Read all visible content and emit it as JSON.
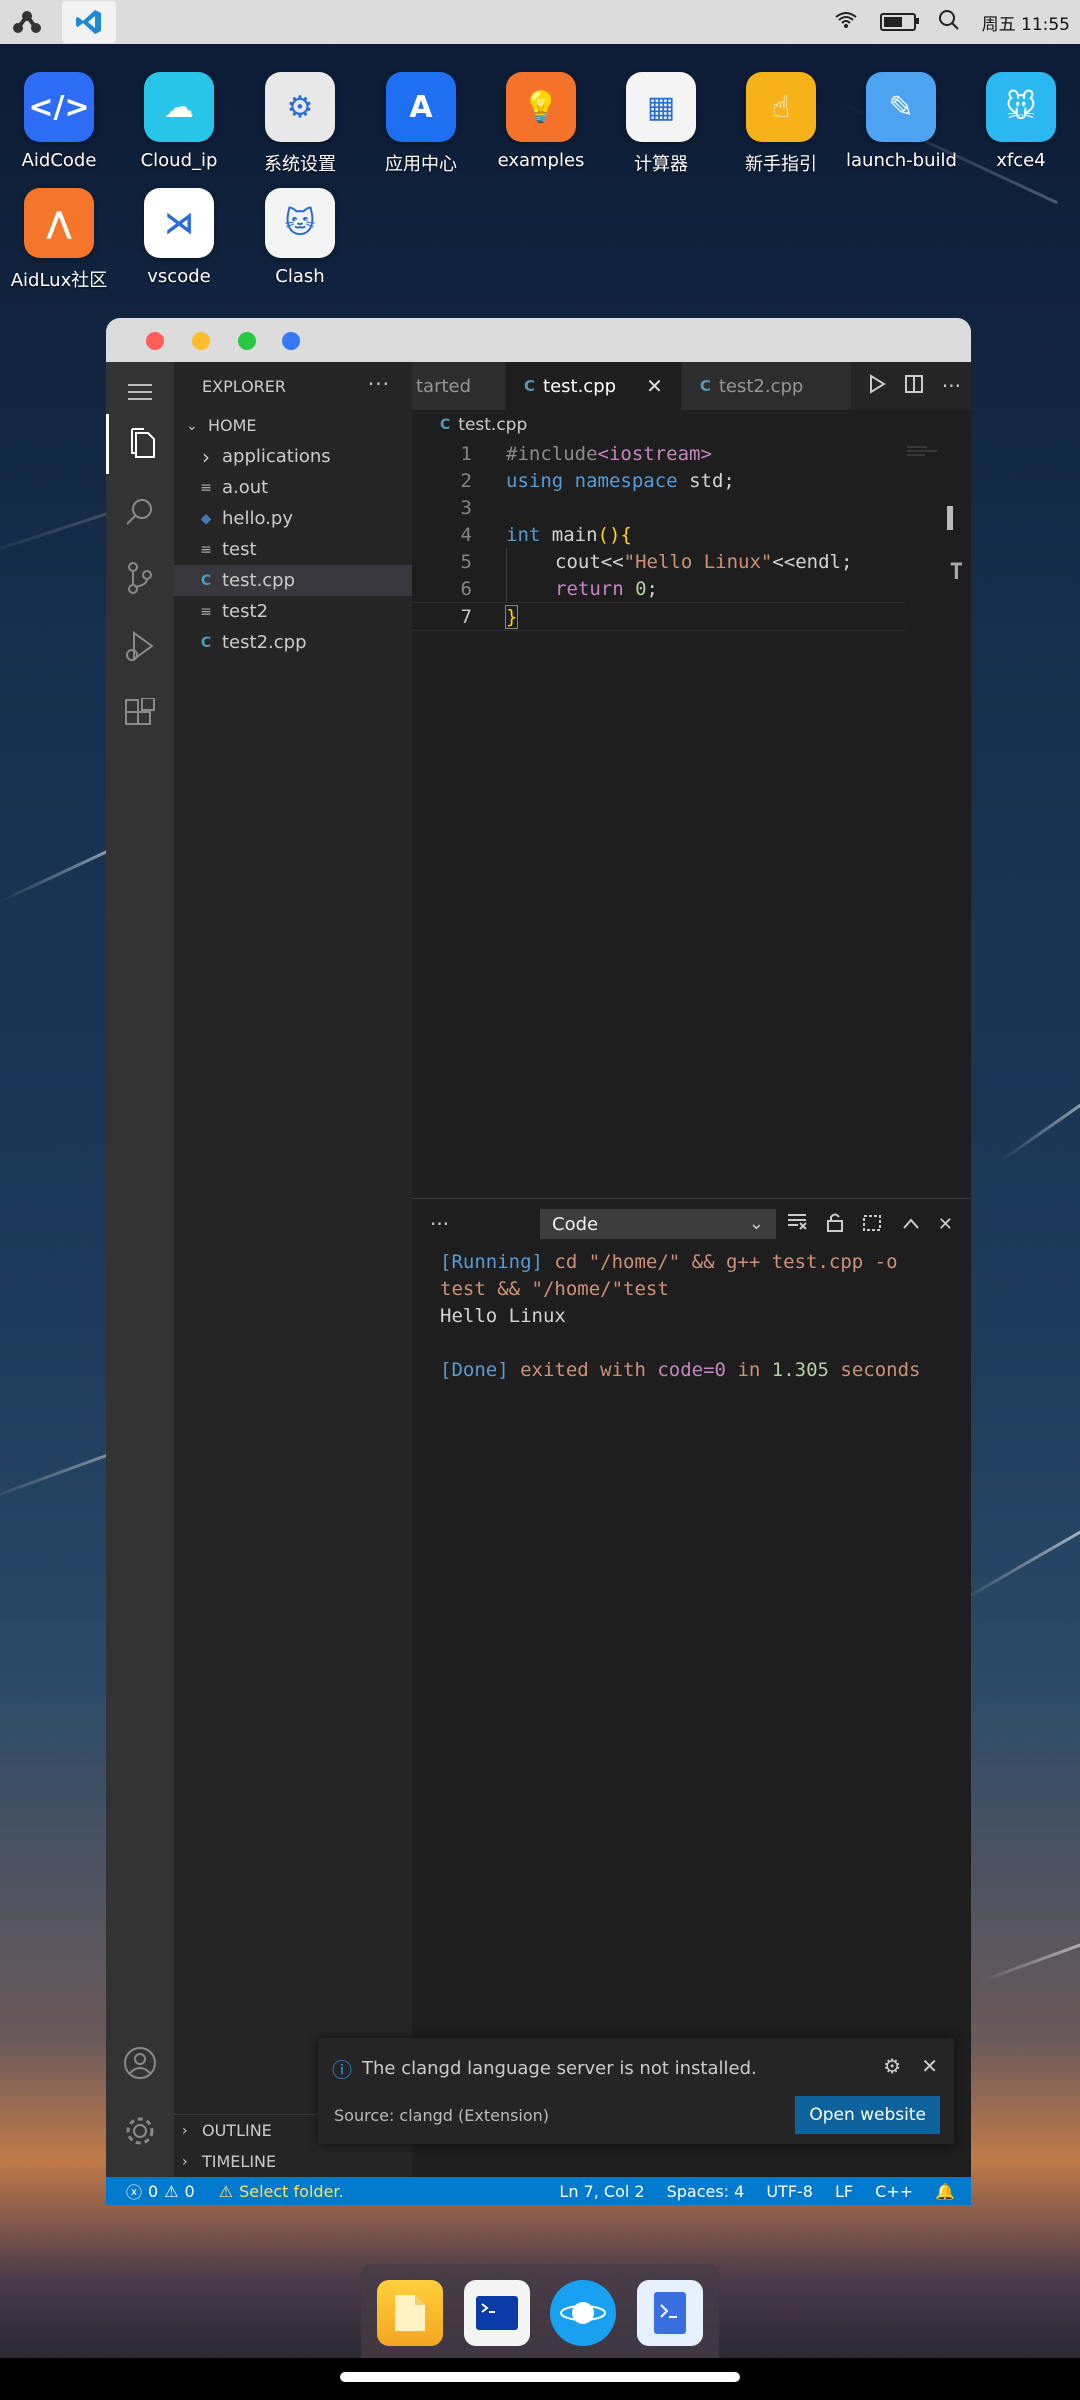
{
  "statusbar": {
    "time": "周五 11:55"
  },
  "desktop": {
    "icons": [
      {
        "label": "AidCode",
        "color": "#2d6cf5",
        "glyph": "</>"
      },
      {
        "label": "Cloud_ip",
        "color": "#27c6e8",
        "glyph": "☁"
      },
      {
        "label": "系统设置",
        "color": "#e8e8e8",
        "glyph": "⚙"
      },
      {
        "label": "应用中心",
        "color": "#1f6ff2",
        "glyph": "A"
      },
      {
        "label": "examples",
        "color": "#f5722a",
        "glyph": "💡"
      },
      {
        "label": "计算器",
        "color": "#f4f4f4",
        "glyph": "▦"
      },
      {
        "label": "新手指引",
        "color": "#f7b21a",
        "glyph": "☝"
      },
      {
        "label": "launch-build",
        "color": "#4da3f0",
        "glyph": "✎"
      },
      {
        "label": "xfce4",
        "color": "#2bb8f0",
        "glyph": "🐭"
      },
      {
        "label": "AidLux社区",
        "color": "#f5762a",
        "glyph": "⋀"
      },
      {
        "label": "vscode",
        "color": "#ffffff",
        "glyph": "⋊"
      },
      {
        "label": "Clash",
        "color": "#f4f4f4",
        "glyph": "🐱"
      }
    ]
  },
  "sidebar": {
    "title": "EXPLORER",
    "folder": "HOME",
    "items": [
      {
        "label": "applications",
        "kind": "folder"
      },
      {
        "label": "a.out",
        "kind": "file"
      },
      {
        "label": "hello.py",
        "kind": "python"
      },
      {
        "label": "test",
        "kind": "file"
      },
      {
        "label": "test.cpp",
        "kind": "cpp",
        "selected": true
      },
      {
        "label": "test2",
        "kind": "file"
      },
      {
        "label": "test2.cpp",
        "kind": "cpp"
      }
    ],
    "outline": "OUTLINE",
    "timeline": "TIMELINE"
  },
  "tabs": [
    {
      "label": "tarted"
    },
    {
      "label": "test.cpp",
      "active": true
    },
    {
      "label": "test2.cpp"
    }
  ],
  "breadcrumb": "test.cpp",
  "code": {
    "lines": [
      "1",
      "2",
      "3",
      "4",
      "5",
      "6",
      "7"
    ],
    "l1a": "#include",
    "l1b": "<iostream>",
    "l2a": "using",
    "l2b": "namespace",
    "l2c": "std;",
    "l4a": "int",
    "l4b": "main",
    "l4c": "()",
    "l4d": "{",
    "l5a": "cout<<",
    "l5b": "\"Hello Linux\"",
    "l5c": "<<endl;",
    "l6a": "return",
    "l6b": "0",
    "l6c": ";",
    "l7a": "}"
  },
  "panel": {
    "dropdown": "Code",
    "out1a": "[Running]",
    "out1b": " cd \"/home/\" && g++ test.cpp -o",
    "out2": "test && \"/home/\"test",
    "out3": "Hello Linux",
    "out5a": "[Done]",
    "out5b": " exited with ",
    "out5c": "code=0",
    "out5d": " in ",
    "out5e": "1.305",
    "out5f": " seconds"
  },
  "toast": {
    "message": "The clangd language server is not installed.",
    "source": "Source: clangd (Extension)",
    "button": "Open website"
  },
  "statusline": {
    "errors": "0",
    "warnings": "0",
    "select_folder": "Select folder.",
    "position": "Ln 7, Col 2",
    "spaces": "Spaces: 4",
    "encoding": "UTF-8",
    "eol": "LF",
    "language": "C++"
  }
}
